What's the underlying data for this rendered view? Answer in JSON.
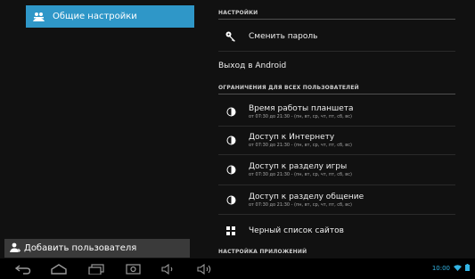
{
  "left_pane": {
    "selected_item": {
      "label": "Общие настройки",
      "icon": "users-icon"
    },
    "add_user": {
      "label": "Добавить пользователя",
      "icon": "add-user-icon"
    }
  },
  "right_pane": {
    "settings_header": "НАСТРОЙКИ",
    "change_password": {
      "label": "Сменить пароль",
      "icon": "key-icon"
    },
    "exit_android": {
      "label": "Выход в Android"
    },
    "restrictions_header": "ОГРАНИЧЕНИЯ ДЛЯ ВСЕХ ПОЛЬЗОВАТЕЛЕЙ",
    "restrictions": [
      {
        "title": "Время работы планшета",
        "subtitle": "от 07:30 до 21:30 - (пн, вт, ср, чт, пт, сб, вс)",
        "icon": "clock-icon"
      },
      {
        "title": "Доступ к Интернету",
        "subtitle": "от 07:30 до 21:30 - (пн, вт, ср, чт, пт, сб, вс)",
        "icon": "clock-icon"
      },
      {
        "title": "Доступ к разделу игры",
        "subtitle": "от 07:30 до 21:30 - (пн, вт, ср, чт, пт, сб, вс)",
        "icon": "clock-icon"
      },
      {
        "title": "Доступ к разделу общение",
        "subtitle": "от 07:30 до 21:30 - (пн, вт, ср, чт, пт, сб, вс)",
        "icon": "clock-icon"
      }
    ],
    "blacklist": {
      "label": "Черный список сайтов",
      "icon": "grid-icon"
    },
    "app_settings_header": "НАСТРОЙКА ПРИЛОЖЕНИЙ"
  },
  "navbar": {
    "buttons": [
      "back-icon",
      "home-icon",
      "recent-apps-icon",
      "screenshot-icon",
      "volume-down-icon",
      "volume-up-icon"
    ],
    "time": "10:00"
  },
  "colors": {
    "accent": "#2f97c8",
    "status": "#33b5e5",
    "background": "#111111"
  }
}
